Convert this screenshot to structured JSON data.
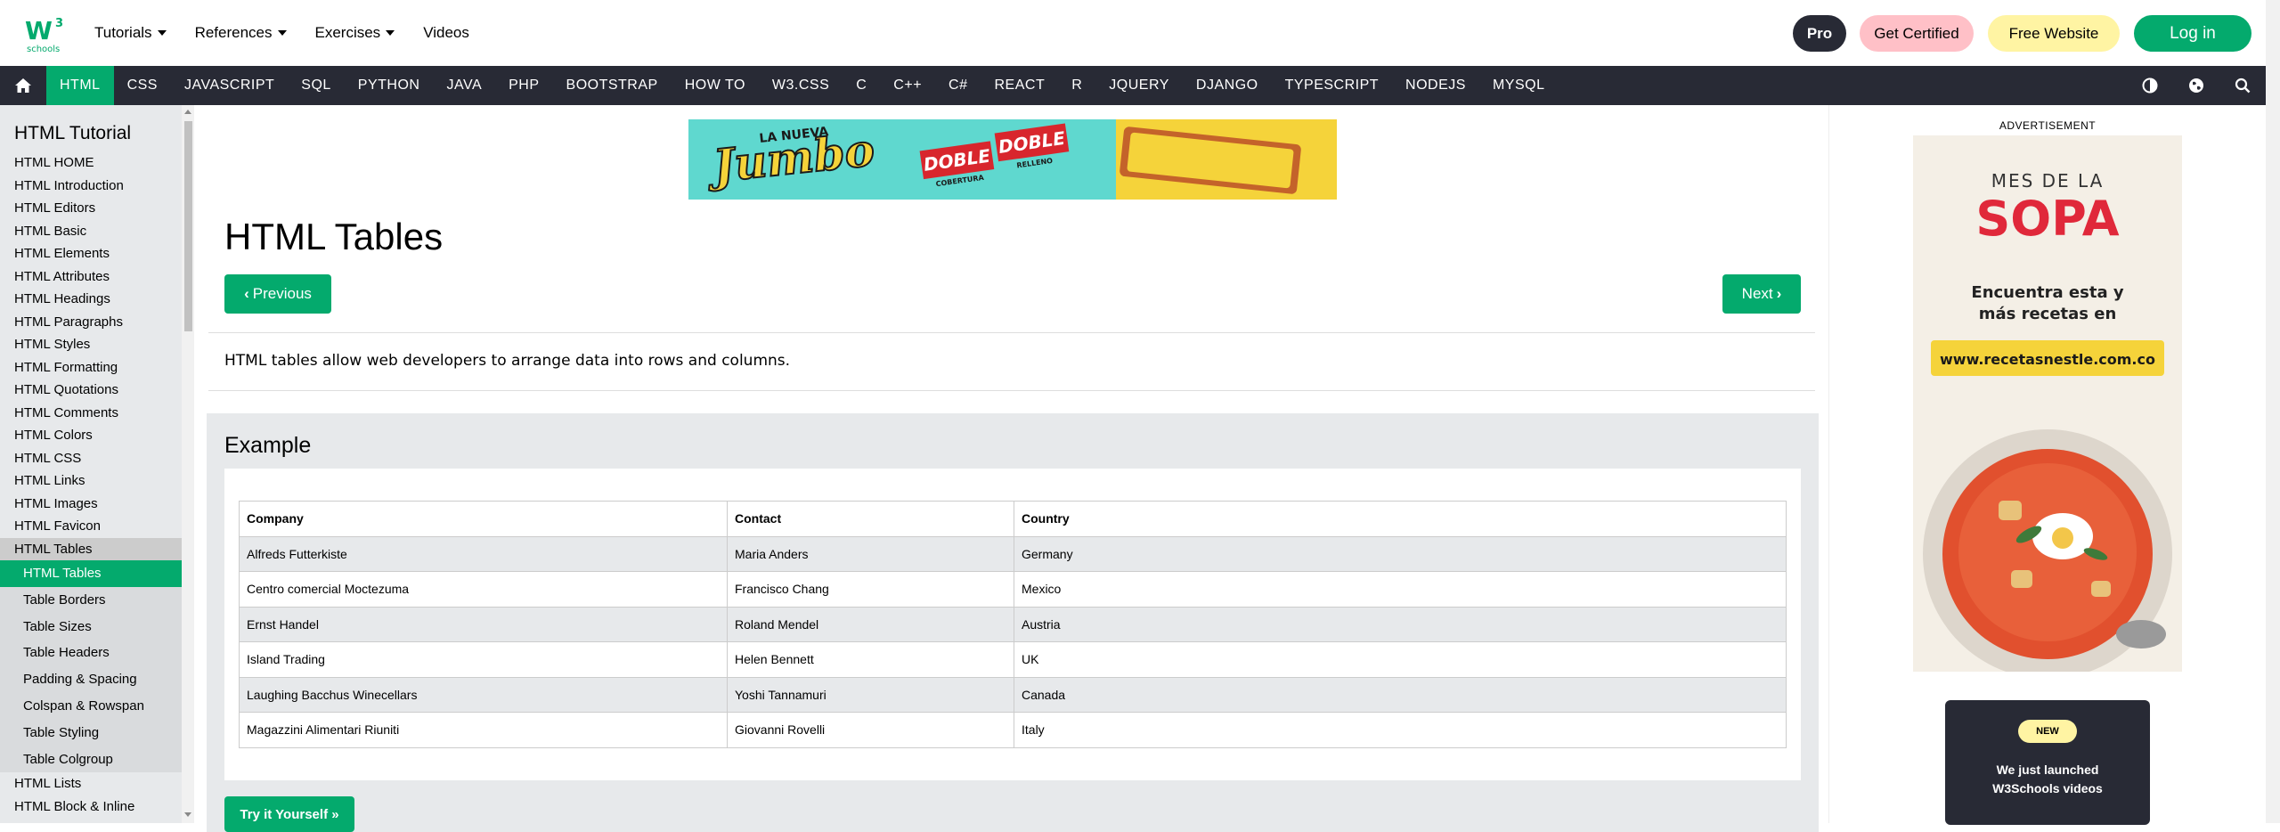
{
  "topnav": {
    "items": [
      {
        "label": "Tutorials",
        "dropdown": true
      },
      {
        "label": "References",
        "dropdown": true
      },
      {
        "label": "Exercises",
        "dropdown": true
      },
      {
        "label": "Videos",
        "dropdown": false
      }
    ],
    "pro_label": "Pro",
    "certified_label": "Get Certified",
    "free_website_label": "Free Website",
    "login_label": "Log in"
  },
  "logo": {
    "text_w": "W",
    "text_3": "3",
    "text_schools": "schools"
  },
  "subnav": {
    "items": [
      "HTML",
      "CSS",
      "JAVASCRIPT",
      "SQL",
      "PYTHON",
      "JAVA",
      "PHP",
      "BOOTSTRAP",
      "HOW TO",
      "W3.CSS",
      "C",
      "C++",
      "C#",
      "REACT",
      "R",
      "JQUERY",
      "DJANGO",
      "TYPESCRIPT",
      "NODEJS",
      "MYSQL"
    ],
    "active": "HTML"
  },
  "sidebar": {
    "title": "HTML Tutorial",
    "items": [
      "HTML HOME",
      "HTML Introduction",
      "HTML Editors",
      "HTML Basic",
      "HTML Elements",
      "HTML Attributes",
      "HTML Headings",
      "HTML Paragraphs",
      "HTML Styles",
      "HTML Formatting",
      "HTML Quotations",
      "HTML Comments",
      "HTML Colors",
      "HTML CSS",
      "HTML Links",
      "HTML Images",
      "HTML Favicon",
      "HTML Tables"
    ],
    "subitems": [
      "HTML Tables",
      "Table Borders",
      "Table Sizes",
      "Table Headers",
      "Padding & Spacing",
      "Colspan & Rowspan",
      "Table Styling",
      "Table Colgroup"
    ],
    "after": [
      "HTML Lists",
      "HTML Block & Inline"
    ]
  },
  "ads": {
    "top": {
      "line1": "LA NUEVA",
      "brand": "Jumbo",
      "doble1": "DOBLE",
      "doble1_sub": "COBERTURA",
      "doble2": "DOBLE",
      "doble2_sub": "RELLENO"
    },
    "side": {
      "label": "ADVERTISEMENT",
      "line1": "MES DE LA",
      "line2": "SOPA",
      "line3": "Encuentra esta y",
      "line4": "más recetas en",
      "url": "www.recetasnestle.com.co"
    }
  },
  "main": {
    "title": "HTML Tables",
    "prev_label": "Previous",
    "next_label": "Next",
    "intro": "HTML tables allow web developers to arrange data into rows and columns.",
    "example_title": "Example",
    "try_label": "Try it Yourself »"
  },
  "table": {
    "headers": [
      "Company",
      "Contact",
      "Country"
    ],
    "rows": [
      [
        "Alfreds Futterkiste",
        "Maria Anders",
        "Germany"
      ],
      [
        "Centro comercial Moctezuma",
        "Francisco Chang",
        "Mexico"
      ],
      [
        "Ernst Handel",
        "Roland Mendel",
        "Austria"
      ],
      [
        "Island Trading",
        "Helen Bennett",
        "UK"
      ],
      [
        "Laughing Bacchus Winecellars",
        "Yoshi Tannamuri",
        "Canada"
      ],
      [
        "Magazzini Alimentari Riuniti",
        "Giovanni Rovelli",
        "Italy"
      ]
    ]
  },
  "promo": {
    "badge": "NEW",
    "line1": "We just launched",
    "line2": "W3Schools videos"
  },
  "colors": {
    "accent": "#04aa6d",
    "dark": "#282a35",
    "cert": "#ffc0c7",
    "free": "#fff4a3",
    "panel": "#e7e9eb"
  }
}
